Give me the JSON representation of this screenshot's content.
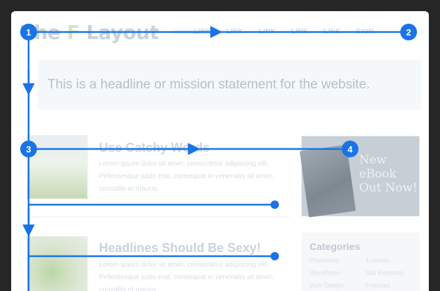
{
  "site": {
    "logo_main": "The",
    "logo_f": "F",
    "logo_rest": "Layout",
    "nav": [
      "LINK",
      "LINK",
      "LINK",
      "LINK",
      "LINK",
      "SIGN"
    ],
    "headline": "This is a headline or mission statement for the website."
  },
  "articles": [
    {
      "title": "Use Catchy Words",
      "body": "Lorem ipsum dolor sit amet, consectetur adipiscing elit. Pellentesque justo erat, consequat in venenatis sit amet, convallis et mauris."
    },
    {
      "title": "Headlines Should Be Sexy!",
      "body": "Lorem ipsum dolor sit amet, consectetur adipiscing elit. Pellentesque justo erat, consequat in venenatis sit amet, convallis et mauris."
    }
  ],
  "ebook": {
    "line1": "New",
    "line2": "eBook",
    "line3": "Out Now!"
  },
  "categories": {
    "title": "Categories",
    "col1": [
      "Photoshop",
      "WordPress",
      "Web Design"
    ],
    "col2": [
      "Tutorials",
      "Site Elements",
      "Freebies"
    ]
  },
  "annotations": {
    "badges": [
      "1",
      "2",
      "3",
      "4"
    ],
    "accent": "#1a73e8"
  }
}
